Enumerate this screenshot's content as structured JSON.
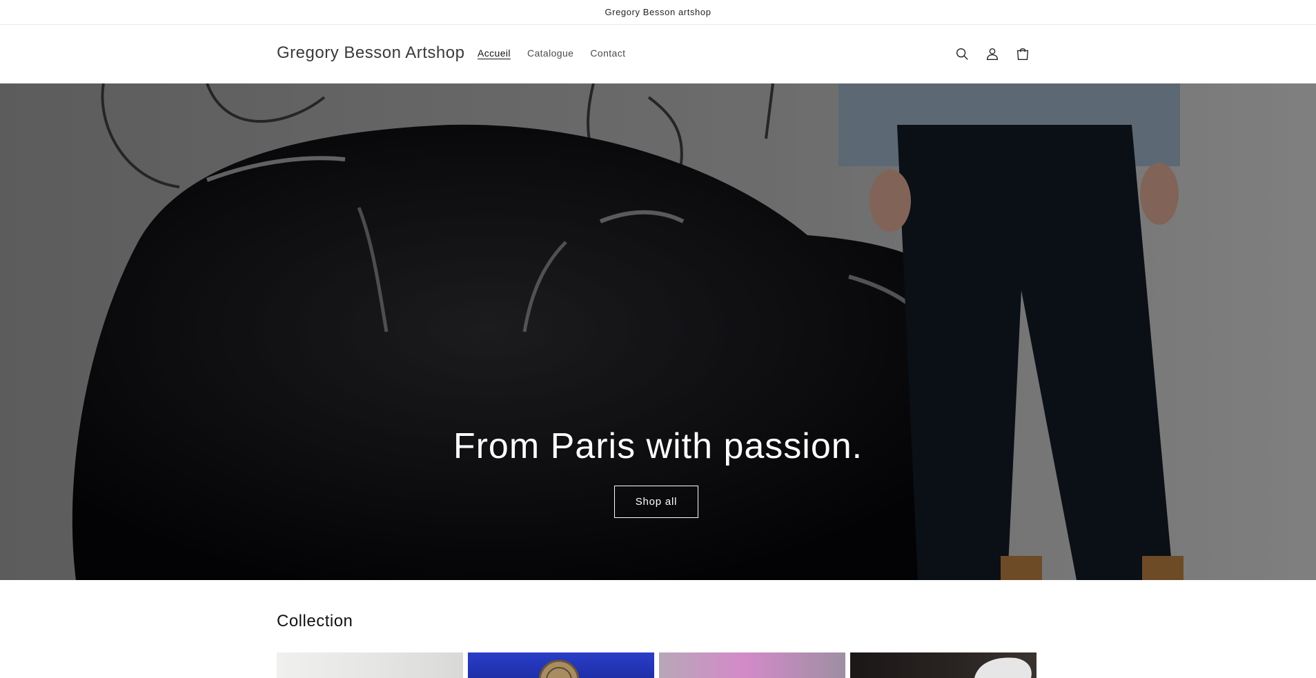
{
  "announcement": {
    "text": "Gregory Besson artshop"
  },
  "header": {
    "brand": "Gregory Besson Artshop",
    "nav": [
      {
        "label": "Accueil",
        "active": true
      },
      {
        "label": "Catalogue",
        "active": false
      },
      {
        "label": "Contact",
        "active": false
      }
    ],
    "icons": [
      "search-icon",
      "account-icon",
      "cart-icon"
    ]
  },
  "hero": {
    "heading": "From Paris with passion.",
    "button_label": "Shop all"
  },
  "collection": {
    "title": "Collection"
  },
  "colors": {
    "accent": "#121212",
    "hero_overlay": "#000000"
  }
}
